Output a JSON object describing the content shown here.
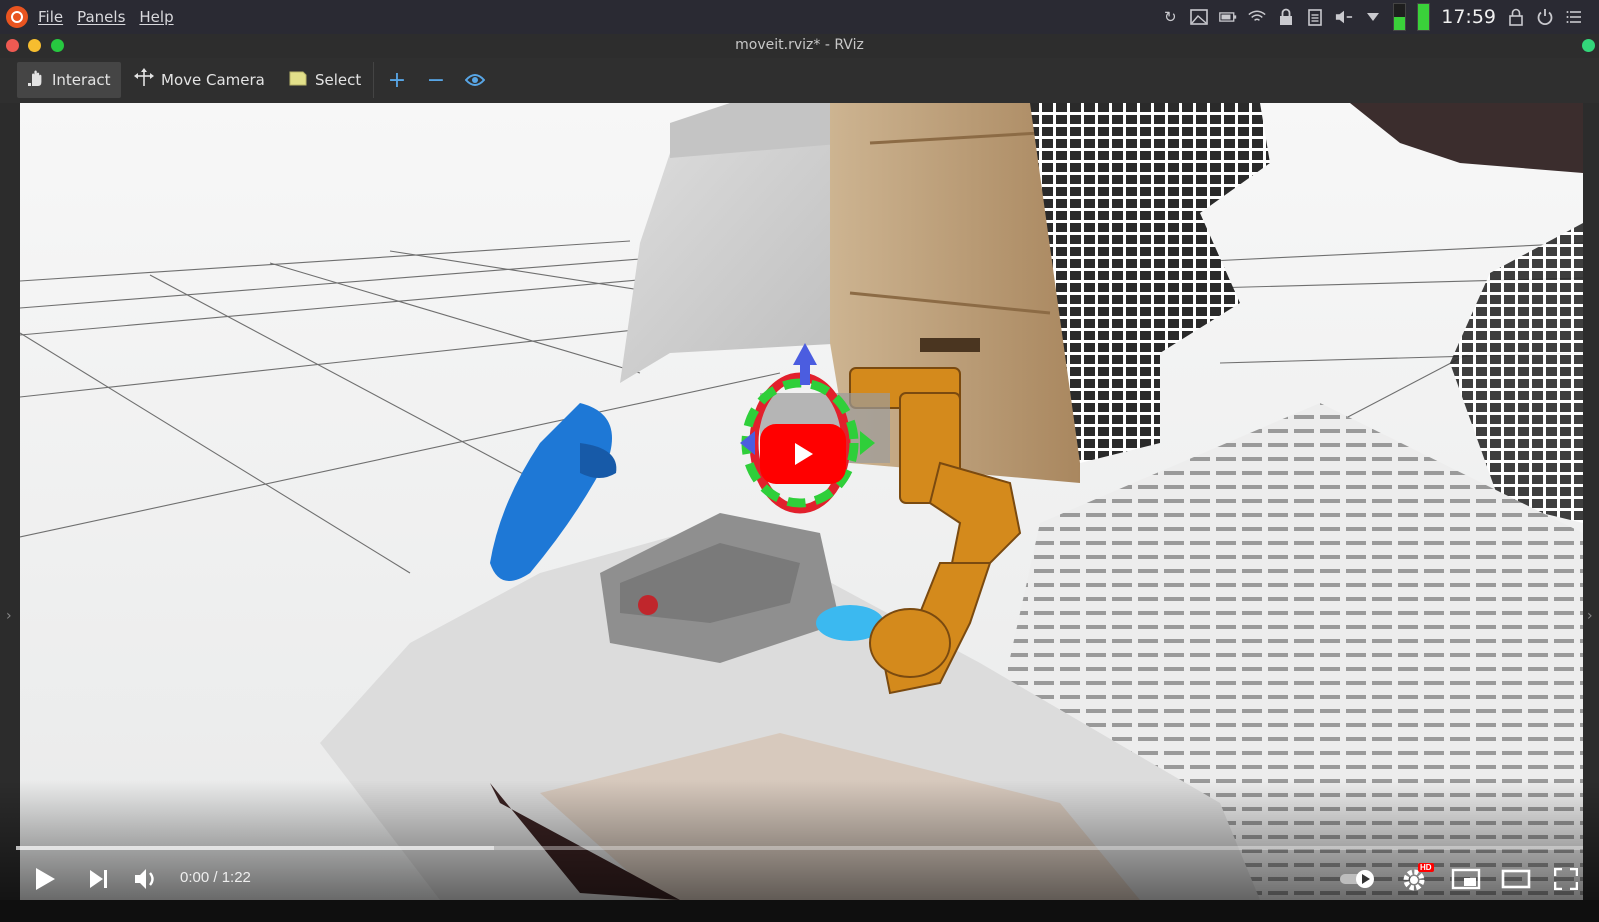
{
  "menubar": {
    "logo_icon": "ubuntu-logo",
    "items": [
      "File",
      "Panels",
      "Help"
    ],
    "clock": "17:59",
    "tray_icons": [
      "sync-icon",
      "image-icon",
      "battery-icon",
      "wifi-icon",
      "lock-icon",
      "clipboard-icon",
      "volume-icon",
      "dropdown-icon",
      "battery-level-low-icon",
      "battery-level-full-icon",
      "screen-lock-icon",
      "power-icon",
      "settings-list-icon"
    ]
  },
  "window": {
    "title": "moveit.rviz* - RViz",
    "controls": [
      "close",
      "minimize",
      "maximize"
    ]
  },
  "toolbar": {
    "tools": [
      {
        "label": "Interact",
        "icon": "hand-pointer-icon",
        "active": true
      },
      {
        "label": "Move Camera",
        "icon": "move-arrows-icon",
        "active": false
      },
      {
        "label": "Select",
        "icon": "select-box-icon",
        "active": false
      }
    ],
    "add_icon": "plus-icon",
    "remove_icon": "minus-icon",
    "visibility_icon": "eye-icon"
  },
  "player": {
    "time": "0:00 / 1:22",
    "progress": 0.0,
    "buffered": 0.305,
    "quality_badge": "HD",
    "colors": {
      "play_button": "#ff0000",
      "accent": "#ffffff"
    }
  }
}
